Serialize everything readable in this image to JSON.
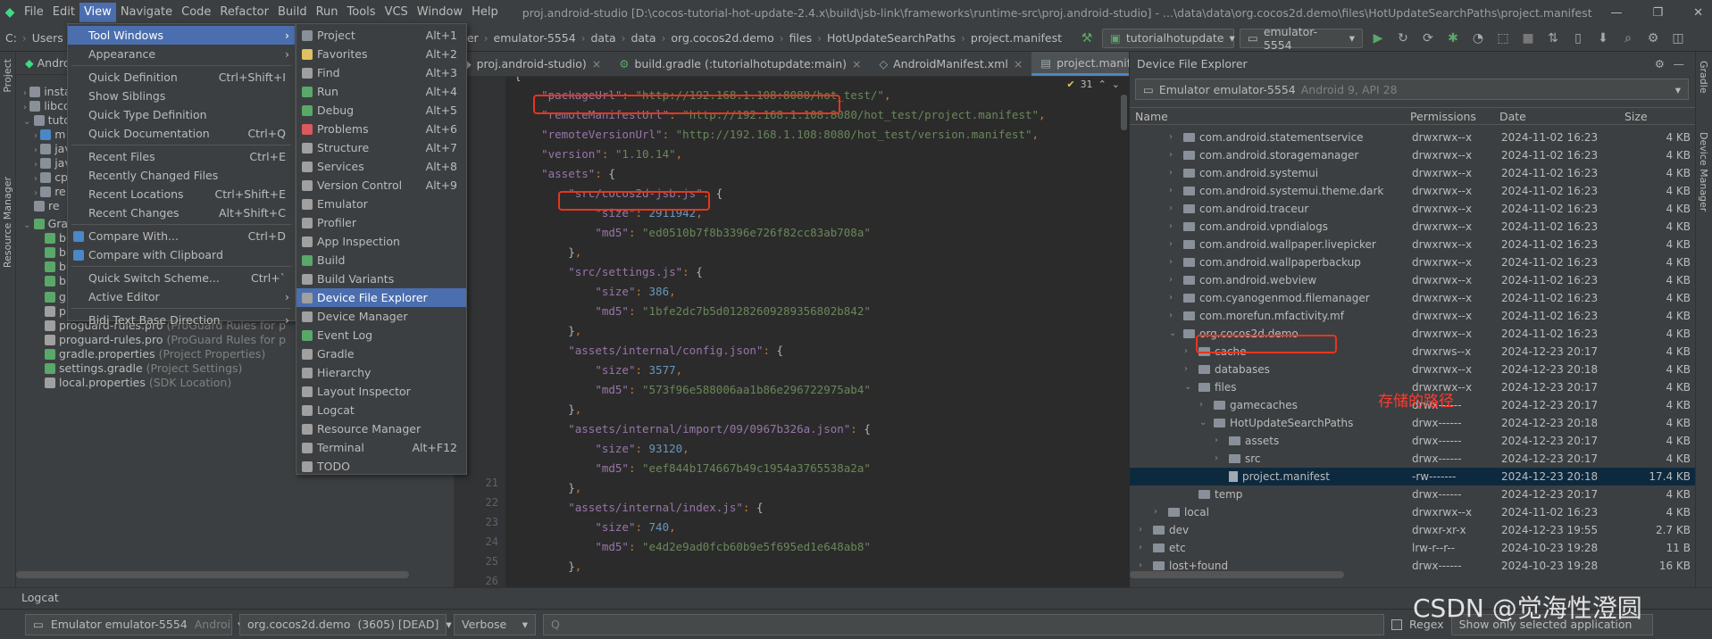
{
  "menubar": {
    "items": [
      "File",
      "Edit",
      "View",
      "Navigate",
      "Code",
      "Refactor",
      "Build",
      "Run",
      "Tools",
      "VCS",
      "Window",
      "Help"
    ],
    "title": "proj.android-studio [D:\\cocos-tutorial-hot-update-2.4.x\\build\\jsb-link\\frameworks\\runtime-src\\proj.android-studio] - ...\\data\\data\\org.cocos2d.demo\\files\\HotUpdateSearchPaths\\project.manifest"
  },
  "navbar": {
    "left": [
      "C:",
      "Users",
      "a"
    ],
    "crumbs": [
      "rer",
      "emulator-5554",
      "data",
      "data",
      "org.cocos2d.demo",
      "files",
      "HotUpdateSearchPaths",
      "project.manifest"
    ],
    "run_config": "tutorialhotupdate",
    "device": "emulator-5554"
  },
  "left_strip": {
    "project": "Project",
    "resource_manager": "Resource Manager"
  },
  "project_panel": {
    "header": "Androi",
    "tree": [
      {
        "label": "insta",
        "ann": ""
      },
      {
        "label": "libco",
        "ann": ""
      },
      {
        "label": "tutor",
        "ann": ""
      },
      {
        "label": "m",
        "ann": ""
      },
      {
        "label": "jav",
        "ann": ""
      },
      {
        "label": "jav",
        "ann": ""
      },
      {
        "label": "cp",
        "ann": ""
      },
      {
        "label": "re",
        "ann": ""
      },
      {
        "label": "re",
        "ann": ""
      },
      {
        "label": "Grad",
        "ann": ""
      },
      {
        "label": "bu",
        "ann": ""
      },
      {
        "label": "bu",
        "ann": ""
      },
      {
        "label": "bu",
        "ann": ""
      },
      {
        "label": "bu",
        "ann": ""
      },
      {
        "label": "gradle-wrapper.properties",
        "ann": "(Gradle Versio"
      },
      {
        "label": "proguard-rules.pro",
        "ann": "(ProGuard Rules for p"
      },
      {
        "label": "proguard-rules.pro",
        "ann": "(ProGuard Rules for p"
      },
      {
        "label": "proguard-rules.pro",
        "ann": "(ProGuard Rules for p"
      },
      {
        "label": "gradle.properties",
        "ann": "(Project Properties)"
      },
      {
        "label": "settings.gradle",
        "ann": "(Project Settings)"
      },
      {
        "label": "local.properties",
        "ann": "(SDK Location)"
      }
    ]
  },
  "view_menu": [
    {
      "label": "Tool Windows",
      "shortcut": "",
      "submenu": true,
      "hi": true
    },
    {
      "label": "Appearance",
      "shortcut": "",
      "submenu": true
    },
    {
      "sep": true
    },
    {
      "label": "Quick Definition",
      "shortcut": "Ctrl+Shift+I"
    },
    {
      "label": "Show Siblings",
      "shortcut": ""
    },
    {
      "label": "Quick Type Definition",
      "shortcut": ""
    },
    {
      "label": "Quick Documentation",
      "shortcut": "Ctrl+Q"
    },
    {
      "sep": true
    },
    {
      "label": "Recent Files",
      "shortcut": "Ctrl+E"
    },
    {
      "label": "Recently Changed Files",
      "shortcut": ""
    },
    {
      "label": "Recent Locations",
      "shortcut": "Ctrl+Shift+E"
    },
    {
      "label": "Recent Changes",
      "shortcut": "Alt+Shift+C"
    },
    {
      "sep": true
    },
    {
      "label": "Compare With...",
      "shortcut": "Ctrl+D",
      "icon": "#4a88c7"
    },
    {
      "label": "Compare with Clipboard",
      "shortcut": "",
      "icon": "#4a88c7"
    },
    {
      "sep": true
    },
    {
      "label": "Quick Switch Scheme...",
      "shortcut": "Ctrl+`"
    },
    {
      "label": "Active Editor",
      "shortcut": "",
      "submenu": true
    },
    {
      "sep": true
    },
    {
      "label": "Bidi Text Base Direction",
      "shortcut": "",
      "submenu": true
    }
  ],
  "tool_windows_menu": [
    {
      "label": "Project",
      "shortcut": "Alt+1",
      "icon": "#8a9099"
    },
    {
      "label": "Favorites",
      "shortcut": "Alt+2",
      "icon": "#e0c060"
    },
    {
      "label": "Find",
      "shortcut": "Alt+3",
      "icon": "#a0a0a0"
    },
    {
      "label": "Run",
      "shortcut": "Alt+4",
      "icon": "#59a869"
    },
    {
      "label": "Debug",
      "shortcut": "Alt+5",
      "icon": "#59a869"
    },
    {
      "label": "Problems",
      "shortcut": "Alt+6",
      "icon": "#db5860"
    },
    {
      "label": "Structure",
      "shortcut": "Alt+7",
      "icon": "#a0a0a0"
    },
    {
      "label": "Services",
      "shortcut": "Alt+8",
      "icon": "#a0a0a0"
    },
    {
      "label": "Version Control",
      "shortcut": "Alt+9",
      "icon": "#a0a0a0"
    },
    {
      "label": "Emulator",
      "shortcut": "",
      "icon": "#a0a0a0"
    },
    {
      "label": "Profiler",
      "shortcut": "",
      "icon": "#a0a0a0"
    },
    {
      "label": "App Inspection",
      "shortcut": "",
      "icon": "#a0a0a0"
    },
    {
      "label": "Build",
      "shortcut": "",
      "icon": "#59a869"
    },
    {
      "label": "Build Variants",
      "shortcut": "",
      "icon": "#a0a0a0"
    },
    {
      "label": "Device File Explorer",
      "shortcut": "",
      "icon": "#a0a0a0",
      "hi": true
    },
    {
      "label": "Device Manager",
      "shortcut": "",
      "icon": "#a0a0a0"
    },
    {
      "label": "Event Log",
      "shortcut": "",
      "icon": "#59a869"
    },
    {
      "label": "Gradle",
      "shortcut": "",
      "icon": "#a0a0a0"
    },
    {
      "label": "Hierarchy",
      "shortcut": "",
      "icon": "#a0a0a0"
    },
    {
      "label": "Layout Inspector",
      "shortcut": "",
      "icon": "#a0a0a0"
    },
    {
      "label": "Logcat",
      "shortcut": "",
      "icon": "#a0a0a0"
    },
    {
      "label": "Resource Manager",
      "shortcut": "",
      "icon": "#a0a0a0"
    },
    {
      "label": "Terminal",
      "shortcut": "Alt+F12",
      "icon": "#a0a0a0"
    },
    {
      "label": "TODO",
      "shortcut": "",
      "icon": "#a0a0a0"
    }
  ],
  "editor": {
    "tabs": [
      "proj.android-studio)",
      "build.gradle (:tutorialhotupdate:main)",
      "AndroidManifest.xml",
      "project.manifest"
    ],
    "warning_count": "31",
    "line_numbers": [
      "21",
      "22",
      "23",
      "24",
      "25",
      "26"
    ],
    "lines": [
      "{",
      "    \"packageUrl\": \"http://192.168.1.108:8080/hot_test/\",",
      "    \"remoteManifestUrl\": \"http://192.168.1.108:8080/hot_test/project.manifest\",",
      "    \"remoteVersionUrl\": \"http://192.168.1.108:8080/hot_test/version.manifest\",",
      "    \"version\": \"1.10.14\",",
      "    \"assets\": {",
      "        \"src/cocos2d-jsb.js\": {",
      "            \"size\": 2911942,",
      "            \"md5\": \"ed0510b7f8b3396e726f82cc83ab708a\"",
      "        },",
      "        \"src/settings.js\": {",
      "            \"size\": 386,",
      "            \"md5\": \"1bfe2dc7b5d01282609289356802b842\"",
      "        },",
      "        \"assets/internal/config.json\": {",
      "            \"size\": 3577,",
      "            \"md5\": \"573f96e588006aa1b86e296722975ab4\"",
      "        },",
      "        \"assets/internal/import/09/0967b326a.json\": {",
      "            \"size\": 93120,",
      "            \"md5\": \"eef844b174667b49c1954a3765538a2a\"",
      "        },",
      "        \"assets/internal/index.js\": {",
      "            \"size\": 740,",
      "            \"md5\": \"e4d2e9ad0fcb60b9e5f695ed1e648ab8\"",
      "        },"
    ]
  },
  "device_file_explorer": {
    "title": "Device File Explorer",
    "device": "Emulator emulator-5554",
    "device_meta": "Android 9, API 28",
    "columns": [
      "Name",
      "Permissions",
      "Date",
      "Size"
    ],
    "rows": [
      {
        "name": "com.android.statementservice",
        "perm": "drwxrwx--x",
        "date": "2024-11-02 16:23",
        "size": "4 KB",
        "lvl": 2,
        "type": "folder",
        "chev": "›"
      },
      {
        "name": "com.android.storagemanager",
        "perm": "drwxrwx--x",
        "date": "2024-11-02 16:23",
        "size": "4 KB",
        "lvl": 2,
        "type": "folder",
        "chev": "›"
      },
      {
        "name": "com.android.systemui",
        "perm": "drwxrwx--x",
        "date": "2024-11-02 16:23",
        "size": "4 KB",
        "lvl": 2,
        "type": "folder",
        "chev": "›"
      },
      {
        "name": "com.android.systemui.theme.dark",
        "perm": "drwxrwx--x",
        "date": "2024-11-02 16:23",
        "size": "4 KB",
        "lvl": 2,
        "type": "folder",
        "chev": "›"
      },
      {
        "name": "com.android.traceur",
        "perm": "drwxrwx--x",
        "date": "2024-11-02 16:23",
        "size": "4 KB",
        "lvl": 2,
        "type": "folder",
        "chev": "›"
      },
      {
        "name": "com.android.vpndialogs",
        "perm": "drwxrwx--x",
        "date": "2024-11-02 16:23",
        "size": "4 KB",
        "lvl": 2,
        "type": "folder",
        "chev": "›"
      },
      {
        "name": "com.android.wallpaper.livepicker",
        "perm": "drwxrwx--x",
        "date": "2024-11-02 16:23",
        "size": "4 KB",
        "lvl": 2,
        "type": "folder",
        "chev": "›"
      },
      {
        "name": "com.android.wallpaperbackup",
        "perm": "drwxrwx--x",
        "date": "2024-11-02 16:23",
        "size": "4 KB",
        "lvl": 2,
        "type": "folder",
        "chev": "›"
      },
      {
        "name": "com.android.webview",
        "perm": "drwxrwx--x",
        "date": "2024-11-02 16:23",
        "size": "4 KB",
        "lvl": 2,
        "type": "folder",
        "chev": "›"
      },
      {
        "name": "com.cyanogenmod.filemanager",
        "perm": "drwxrwx--x",
        "date": "2024-11-02 16:23",
        "size": "4 KB",
        "lvl": 2,
        "type": "folder",
        "chev": "›"
      },
      {
        "name": "com.morefun.mfactivity.mf",
        "perm": "drwxrwx--x",
        "date": "2024-11-02 16:23",
        "size": "4 KB",
        "lvl": 2,
        "type": "folder",
        "chev": "›"
      },
      {
        "name": "org.cocos2d.demo",
        "perm": "drwxrwx--x",
        "date": "2024-11-02 16:23",
        "size": "4 KB",
        "lvl": 2,
        "type": "folder",
        "chev": "⌄"
      },
      {
        "name": "cache",
        "perm": "drwxrws--x",
        "date": "2024-12-23 20:17",
        "size": "4 KB",
        "lvl": 3,
        "type": "folder",
        "chev": "›"
      },
      {
        "name": "databases",
        "perm": "drwxrwx--x",
        "date": "2024-12-23 20:18",
        "size": "4 KB",
        "lvl": 3,
        "type": "folder",
        "chev": "›"
      },
      {
        "name": "files",
        "perm": "drwxrwx--x",
        "date": "2024-12-23 20:17",
        "size": "4 KB",
        "lvl": 3,
        "type": "folder",
        "chev": "⌄"
      },
      {
        "name": "gamecaches",
        "perm": "drwx------",
        "date": "2024-12-23 20:17",
        "size": "4 KB",
        "lvl": 4,
        "type": "folder",
        "chev": "›"
      },
      {
        "name": "HotUpdateSearchPaths",
        "perm": "drwx------",
        "date": "2024-12-23 20:18",
        "size": "4 KB",
        "lvl": 4,
        "type": "folder",
        "chev": "⌄"
      },
      {
        "name": "assets",
        "perm": "drwx------",
        "date": "2024-12-23 20:17",
        "size": "4 KB",
        "lvl": 5,
        "type": "folder",
        "chev": "›"
      },
      {
        "name": "src",
        "perm": "drwx------",
        "date": "2024-12-23 20:17",
        "size": "4 KB",
        "lvl": 5,
        "type": "folder",
        "chev": "›"
      },
      {
        "name": "project.manifest",
        "perm": "-rw-------",
        "date": "2024-12-23 20:18",
        "size": "17.4 KB",
        "lvl": 5,
        "type": "file",
        "chev": "",
        "sel": true
      },
      {
        "name": "temp",
        "perm": "drwx------",
        "date": "2024-12-23 20:17",
        "size": "4 KB",
        "lvl": 3,
        "type": "folder",
        "chev": ""
      },
      {
        "name": "local",
        "perm": "drwxrwx--x",
        "date": "2024-11-02 16:23",
        "size": "4 KB",
        "lvl": 1,
        "type": "folder",
        "chev": "›"
      },
      {
        "name": "dev",
        "perm": "drwxr-xr-x",
        "date": "2024-12-23 19:55",
        "size": "2.7 KB",
        "lvl": 0,
        "type": "folder",
        "chev": "›"
      },
      {
        "name": "etc",
        "perm": "lrw-r--r--",
        "date": "2024-10-23 19:28",
        "size": "11 B",
        "lvl": 0,
        "type": "folder",
        "chev": "›"
      },
      {
        "name": "lost+found",
        "perm": "drwx------",
        "date": "2024-10-23 19:28",
        "size": "16 KB",
        "lvl": 0,
        "type": "folder",
        "chev": "›"
      }
    ]
  },
  "right_strip": {
    "gradle": "Gradle",
    "device_manager": "Device Manager"
  },
  "annotation_text": "存储的路径",
  "logcat": {
    "title": "Logcat",
    "device": "Emulator emulator-5554",
    "device_meta": "Androi",
    "process": "org.cocos2d.demo",
    "process_meta": "(3605) [DEAD]",
    "level": "Verbose",
    "search_placeholder": "Q",
    "regex_label": "Regex",
    "filter": "Show only selected application"
  },
  "watermark": "CSDN @觉海性澄圆",
  "colors": {
    "accent": "#4b6eaf",
    "highlight_box": "#e8351d",
    "annotation": "#ff3b30"
  }
}
